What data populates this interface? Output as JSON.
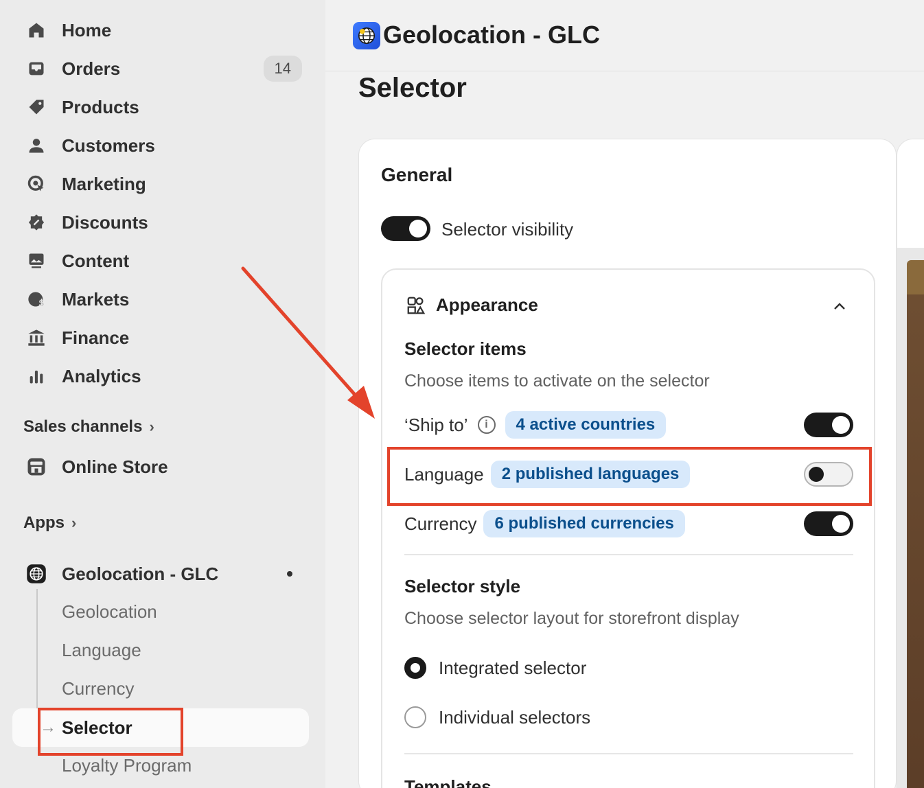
{
  "sidebar": {
    "nav": [
      {
        "label": "Home",
        "icon": "home-icon"
      },
      {
        "label": "Orders",
        "icon": "inbox-icon",
        "badge": "14"
      },
      {
        "label": "Products",
        "icon": "tag-icon"
      },
      {
        "label": "Customers",
        "icon": "person-icon"
      },
      {
        "label": "Marketing",
        "icon": "target-icon"
      },
      {
        "label": "Discounts",
        "icon": "discount-icon"
      },
      {
        "label": "Content",
        "icon": "image-icon"
      },
      {
        "label": "Markets",
        "icon": "globe-dollar-icon"
      },
      {
        "label": "Finance",
        "icon": "bank-icon"
      },
      {
        "label": "Analytics",
        "icon": "bar-chart-icon"
      }
    ],
    "sales_channels": "Sales channels",
    "online_store": "Online Store",
    "apps": "Apps",
    "app_name": "Geolocation - GLC",
    "app_sub": [
      "Geolocation",
      "Language",
      "Currency"
    ],
    "selected": "Selector",
    "loyalty": "Loyalty Program"
  },
  "header": {
    "app_title": "Geolocation - GLC"
  },
  "page": {
    "title": "Selector"
  },
  "general": {
    "title": "General",
    "visibility_label": "Selector visibility",
    "visibility_on": true
  },
  "appearance": {
    "title": "Appearance",
    "items_heading": "Selector items",
    "items_sub": "Choose items to activate on the selector",
    "ship_label": "‘Ship to’",
    "ship_pill": "4 active countries",
    "lang_label": "Language",
    "lang_pill": "2 published languages",
    "curr_label": "Currency",
    "curr_pill": "6 published currencies",
    "style_heading": "Selector style",
    "style_sub": "Choose selector layout for storefront display",
    "opt_integrated": "Integrated selector",
    "opt_individual": "Individual selectors",
    "templates": "Templates"
  },
  "colors": {
    "accent": "#1a1a1a",
    "pill_bg": "#d8e9fb",
    "pill_text": "#0b4f8c",
    "highlight": "#e3432b"
  }
}
